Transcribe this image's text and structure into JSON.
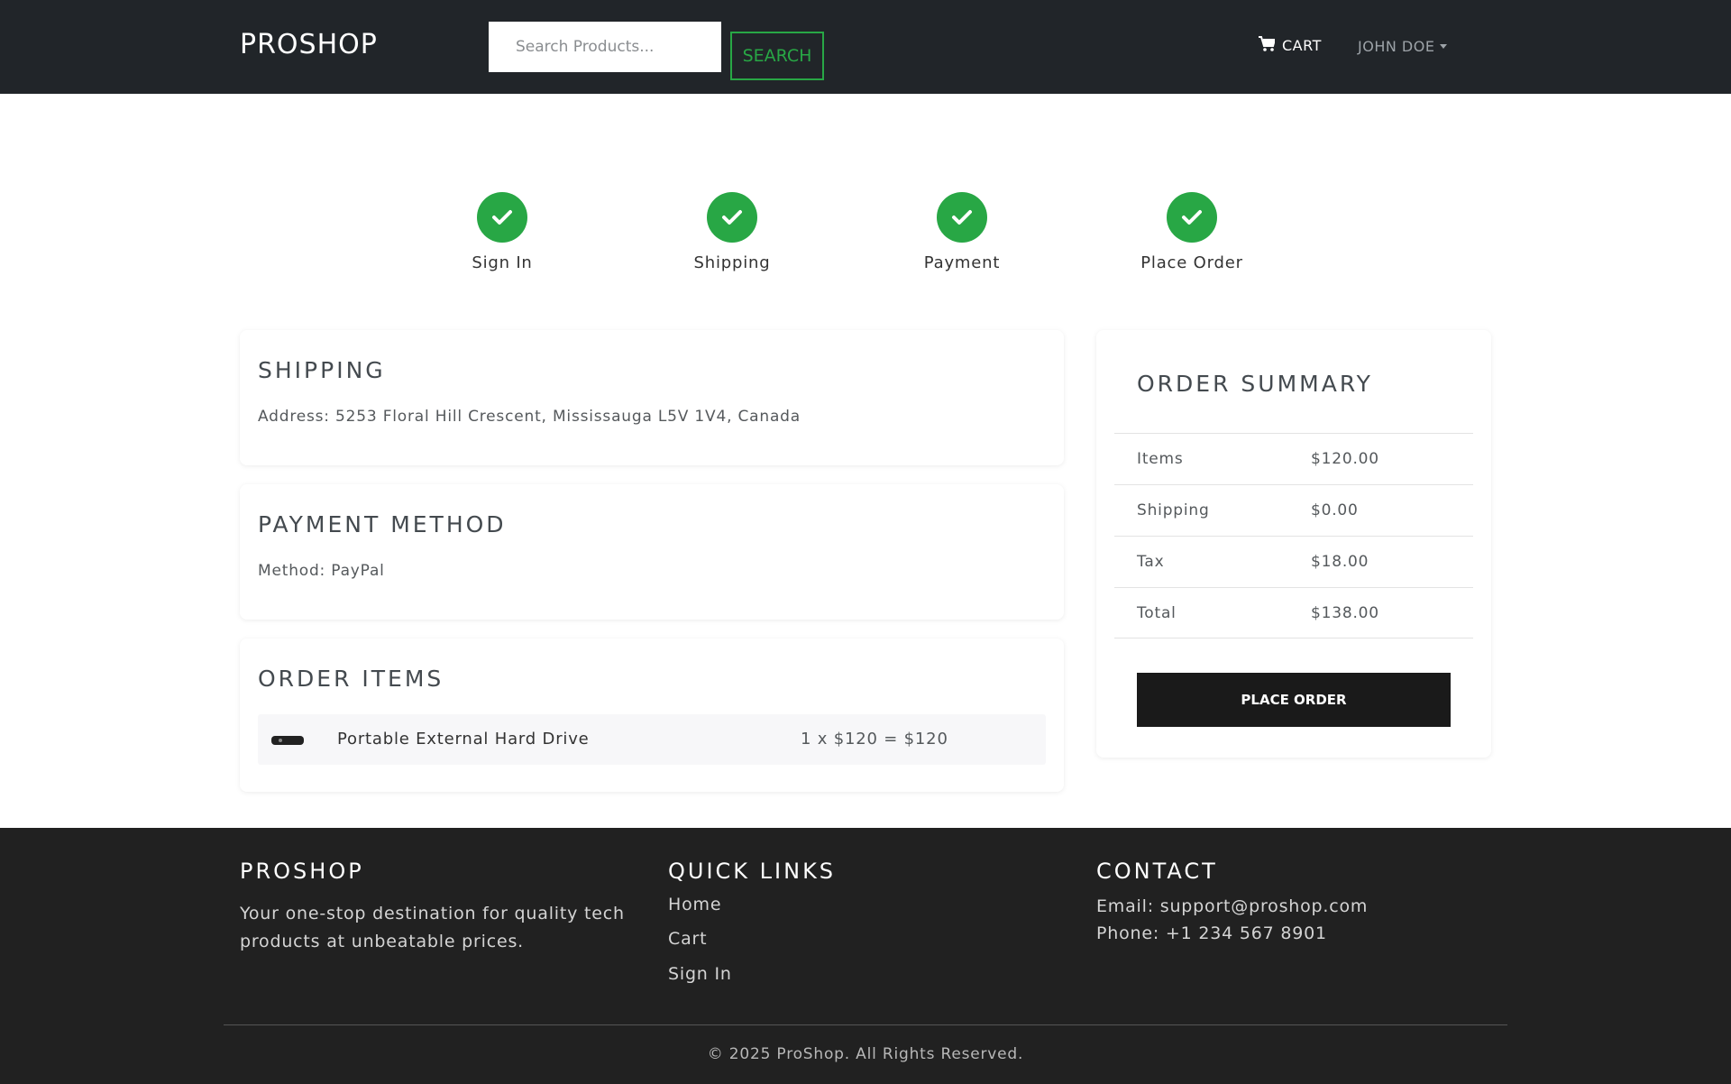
{
  "nav": {
    "brand": "PROSHOP",
    "search_placeholder": "Search Products...",
    "search_button": "SEARCH",
    "cart_label": "CART",
    "user_label": "JOHN DOE"
  },
  "steps": [
    {
      "label": "Sign In",
      "completed": true
    },
    {
      "label": "Shipping",
      "completed": true
    },
    {
      "label": "Payment",
      "completed": true
    },
    {
      "label": "Place Order",
      "completed": true
    }
  ],
  "shipping": {
    "title": "SHIPPING",
    "address": "Address: 5253 Floral Hill Crescent, Mississauga L5V 1V4, Canada"
  },
  "payment": {
    "title": "PAYMENT METHOD",
    "method": "Method: PayPal"
  },
  "order_items": {
    "title": "ORDER ITEMS",
    "items": [
      {
        "name": "Portable External Hard Drive",
        "calc": "1 x $120 = $120"
      }
    ]
  },
  "summary": {
    "title": "ORDER SUMMARY",
    "rows": [
      {
        "label": "Items",
        "value": "$120.00"
      },
      {
        "label": "Shipping",
        "value": "$0.00"
      },
      {
        "label": "Tax",
        "value": "$18.00"
      },
      {
        "label": "Total",
        "value": "$138.00"
      }
    ],
    "button": "PLACE ORDER"
  },
  "footer": {
    "brand": "PROSHOP",
    "tagline": "Your one-stop destination for quality tech products at unbeatable prices.",
    "links_title": "QUICK LINKS",
    "links": [
      "Home",
      "Cart",
      "Sign In"
    ],
    "contact_title": "CONTACT",
    "email": "Email: support@proshop.com",
    "phone": "Phone: +1 234 567 8901",
    "copyright": "© 2025 ProShop. All Rights Reserved."
  },
  "colors": {
    "navbar_bg": "#212529",
    "accent_green": "#28a745",
    "button_dark": "#1a1a1a",
    "footer_bg": "#212121"
  }
}
